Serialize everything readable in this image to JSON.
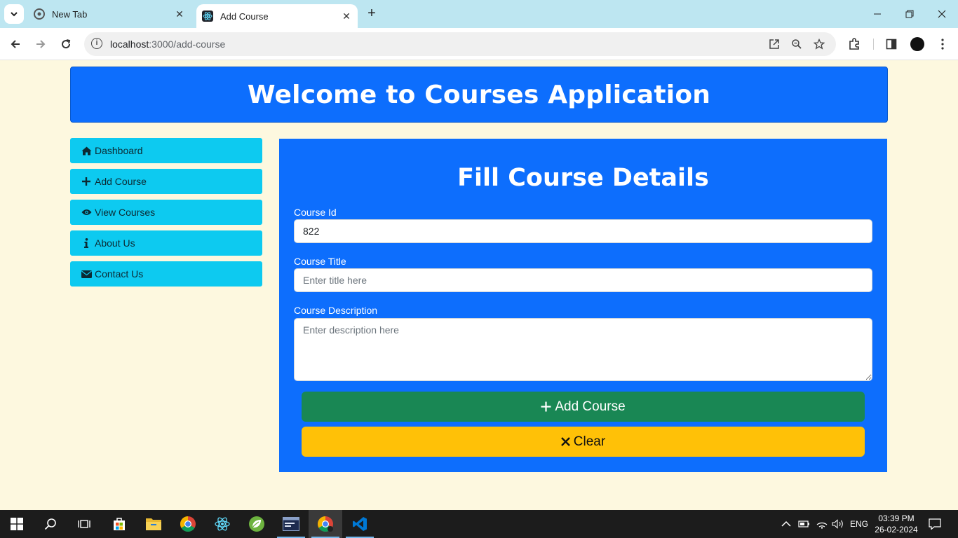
{
  "browser": {
    "tabs": [
      {
        "title": "New Tab",
        "active": false
      },
      {
        "title": "Add Course",
        "active": true
      }
    ],
    "url_host": "localhost",
    "url_path": ":3000/add-course"
  },
  "header": {
    "title": "Welcome to Courses Application"
  },
  "sidebar": {
    "items": [
      {
        "label": "Dashboard",
        "icon": "home-icon"
      },
      {
        "label": "Add Course",
        "icon": "plus-icon"
      },
      {
        "label": "View Courses",
        "icon": "eye-icon"
      },
      {
        "label": "About Us",
        "icon": "info-icon"
      },
      {
        "label": "Contact Us",
        "icon": "envelope-icon"
      }
    ]
  },
  "form": {
    "title": "Fill Course Details",
    "course_id": {
      "label": "Course Id",
      "value": "822"
    },
    "course_title": {
      "label": "Course Title",
      "placeholder": "Enter title here"
    },
    "course_description": {
      "label": "Course Description",
      "placeholder": "Enter description here"
    },
    "add_button": "Add Course",
    "clear_button": "Clear"
  },
  "colors": {
    "primary": "#0d6efd",
    "info": "#0dcaf0",
    "success": "#198754",
    "warning": "#ffc107",
    "page_bg": "#fdf8df"
  },
  "taskbar": {
    "language": "ENG",
    "time": "03:39 PM",
    "date": "26-02-2024"
  }
}
